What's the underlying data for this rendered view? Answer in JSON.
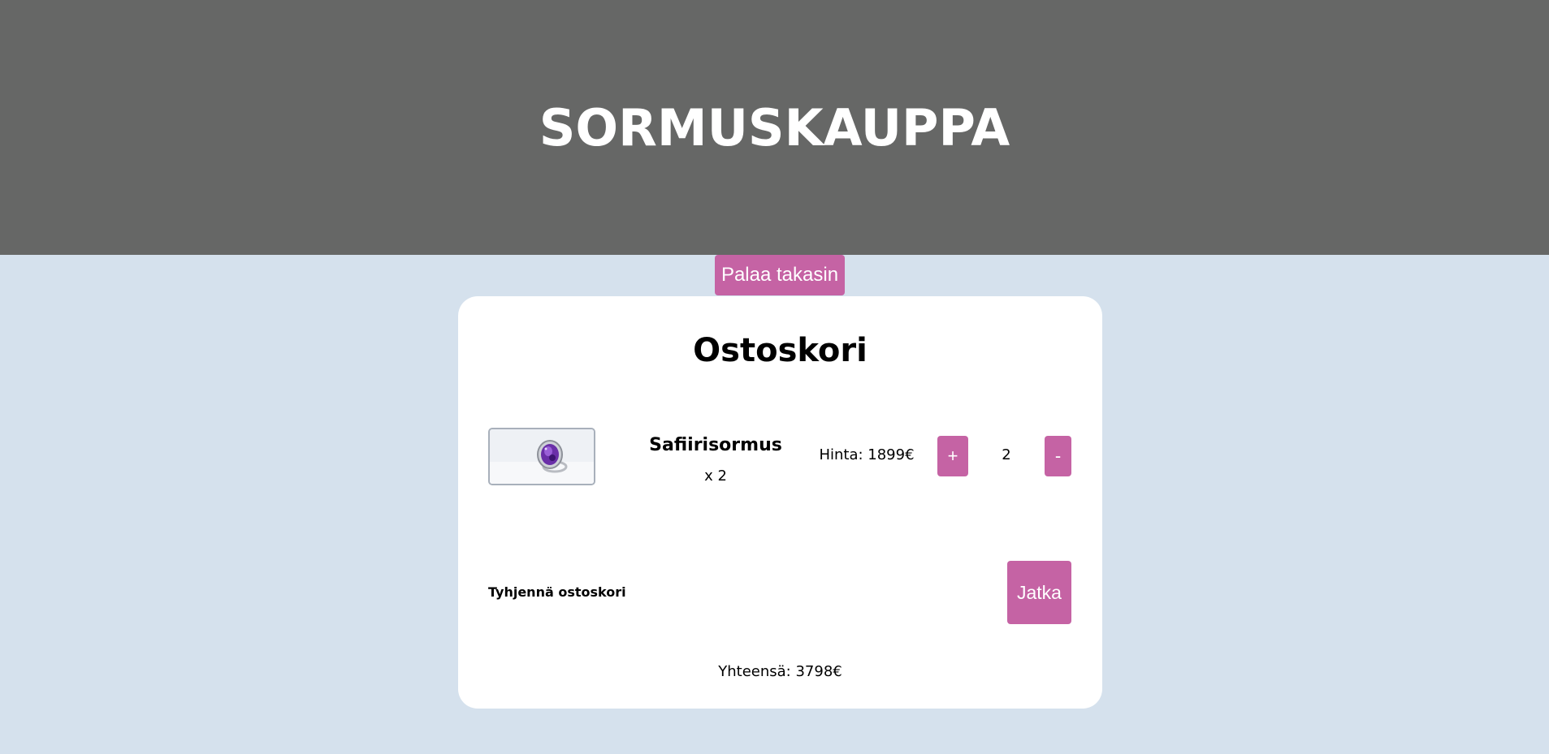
{
  "header": {
    "title": "SORMUSKAUPPA",
    "background_color": "#666766"
  },
  "nav": {
    "back_label": "Palaa takasin"
  },
  "cart": {
    "title": "Ostoskori",
    "items": [
      {
        "image_icon": "amethyst-ring-photo",
        "name": "Safiirisormus",
        "quantity_label": "x 2",
        "price_label": "Hinta: 1899€",
        "increase_label": "+",
        "quantity": "2",
        "decrease_label": "-"
      }
    ],
    "clear_label": "Tyhjennä ostoskori",
    "continue_label": "Jatka",
    "total_label": "Yhteensä: 3798€"
  },
  "colors": {
    "accent": "#c563a4",
    "page_background": "#d5e1ed",
    "card_background": "#ffffff"
  }
}
